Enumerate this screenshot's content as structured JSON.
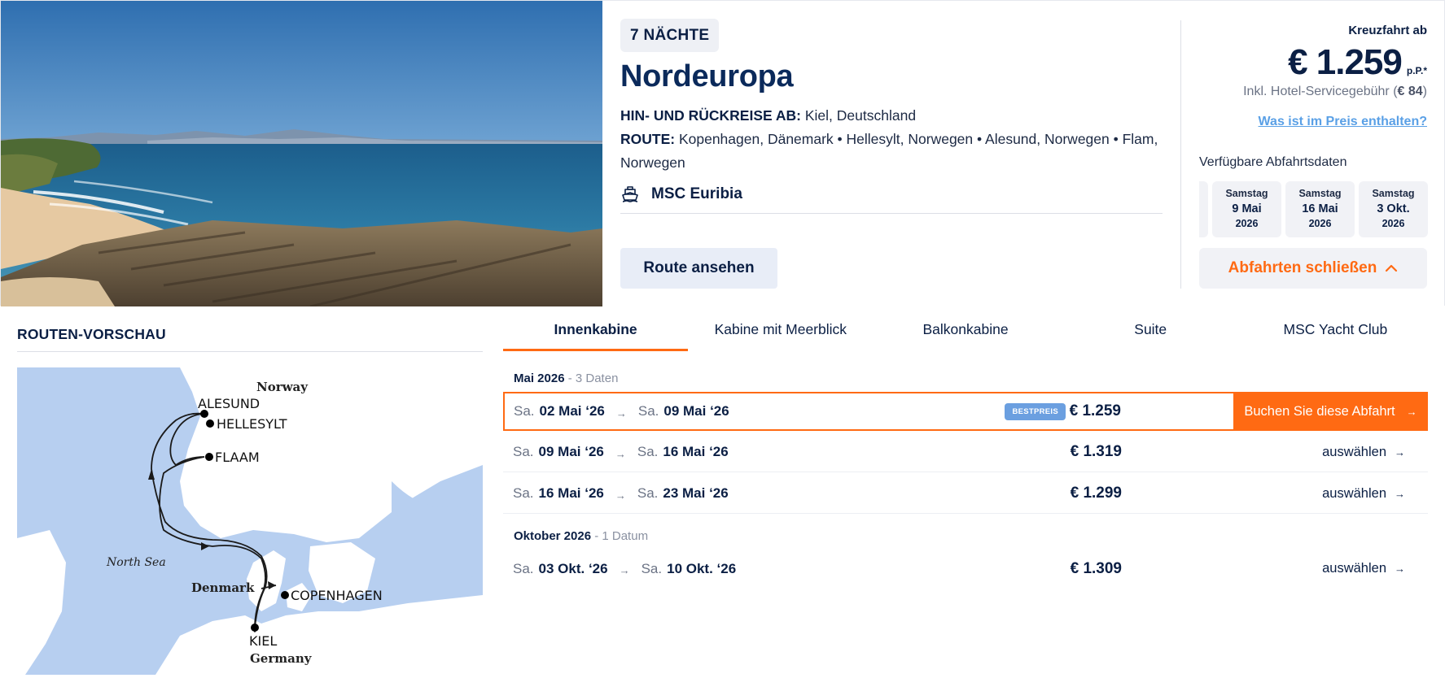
{
  "cruise": {
    "nights_badge": "7 NÄCHTE",
    "title": "Nordeuropa",
    "roundtrip_label": "HIN- UND RÜCKREISE AB:",
    "roundtrip_value": "Kiel, Deutschland",
    "route_label": "ROUTE:",
    "route_value": "Kopenhagen, Dänemark • Hellesylt, Norwegen • Alesund, Norwegen • Flam, Norwegen",
    "ship_icon": "ship-icon",
    "ship_name": "MSC Euribia",
    "route_button": "Route ansehen"
  },
  "pricing": {
    "from_label": "Kreuzfahrt ab",
    "price": "€ 1.259",
    "per_person": "p.P.*",
    "fee_prefix": "Inkl. Hotel-Servicegebühr (",
    "fee_value": "€ 84",
    "fee_suffix": ")",
    "whats_included_link": "Was ist im Preis enthalten?"
  },
  "departures_panel": {
    "label": "Verfügbare Abfahrtsdaten",
    "dates": [
      {
        "weekday": "Samstag",
        "date": "9 Mai",
        "year": "2026"
      },
      {
        "weekday": "Samstag",
        "date": "16 Mai",
        "year": "2026"
      },
      {
        "weekday": "Samstag",
        "date": "3 Okt.",
        "year": "2026"
      }
    ],
    "close_button": "Abfahrten schließen",
    "close_icon": "chevron-up-icon"
  },
  "route_preview": {
    "title": "ROUTEN-VORSCHAU",
    "map_labels": {
      "norway": "Norway",
      "north_sea": "North Sea",
      "denmark": "Denmark",
      "germany": "Germany",
      "alesund": "ALESUND",
      "hellesylt": "HELLESYLT",
      "flaam": "FLAAM",
      "copenhagen": "COPENHAGEN",
      "kiel": "KIEL"
    }
  },
  "cabin_tabs": [
    "Innenkabine",
    "Kabine mit Meerblick",
    "Balkonkabine",
    "Suite",
    "MSC Yacht Club"
  ],
  "months": [
    {
      "name": "Mai 2026",
      "count": " - 3 Daten"
    },
    {
      "name": "Oktober 2026",
      "count": " - 1 Datum"
    }
  ],
  "sailings": [
    {
      "dow_out": "Sa.",
      "out": "02 Mai ‘26",
      "dow_back": "Sa.",
      "back": "09 Mai ‘26",
      "price": "€ 1.259",
      "badge": "BESTPREIS",
      "action": "Buchen Sie diese Abfahrt"
    },
    {
      "dow_out": "Sa.",
      "out": "09 Mai ‘26",
      "dow_back": "Sa.",
      "back": "16 Mai ‘26",
      "price": "€ 1.319",
      "action": "auswählen"
    },
    {
      "dow_out": "Sa.",
      "out": "16 Mai ‘26",
      "dow_back": "Sa.",
      "back": "23 Mai ‘26",
      "price": "€ 1.299",
      "action": "auswählen"
    },
    {
      "dow_out": "Sa.",
      "out": "03 Okt. ‘26",
      "dow_back": "Sa.",
      "back": "10 Okt. ‘26",
      "price": "€ 1.309",
      "action": "auswählen"
    }
  ],
  "arrow_glyph": "→",
  "colors": {
    "accent_orange": "#ff6a13",
    "navy": "#0b1f44",
    "link_blue": "#5aa0e6",
    "badge_blue": "#6b9fe0",
    "map_sea": "#b7cff0",
    "map_land": "#ffffff"
  }
}
